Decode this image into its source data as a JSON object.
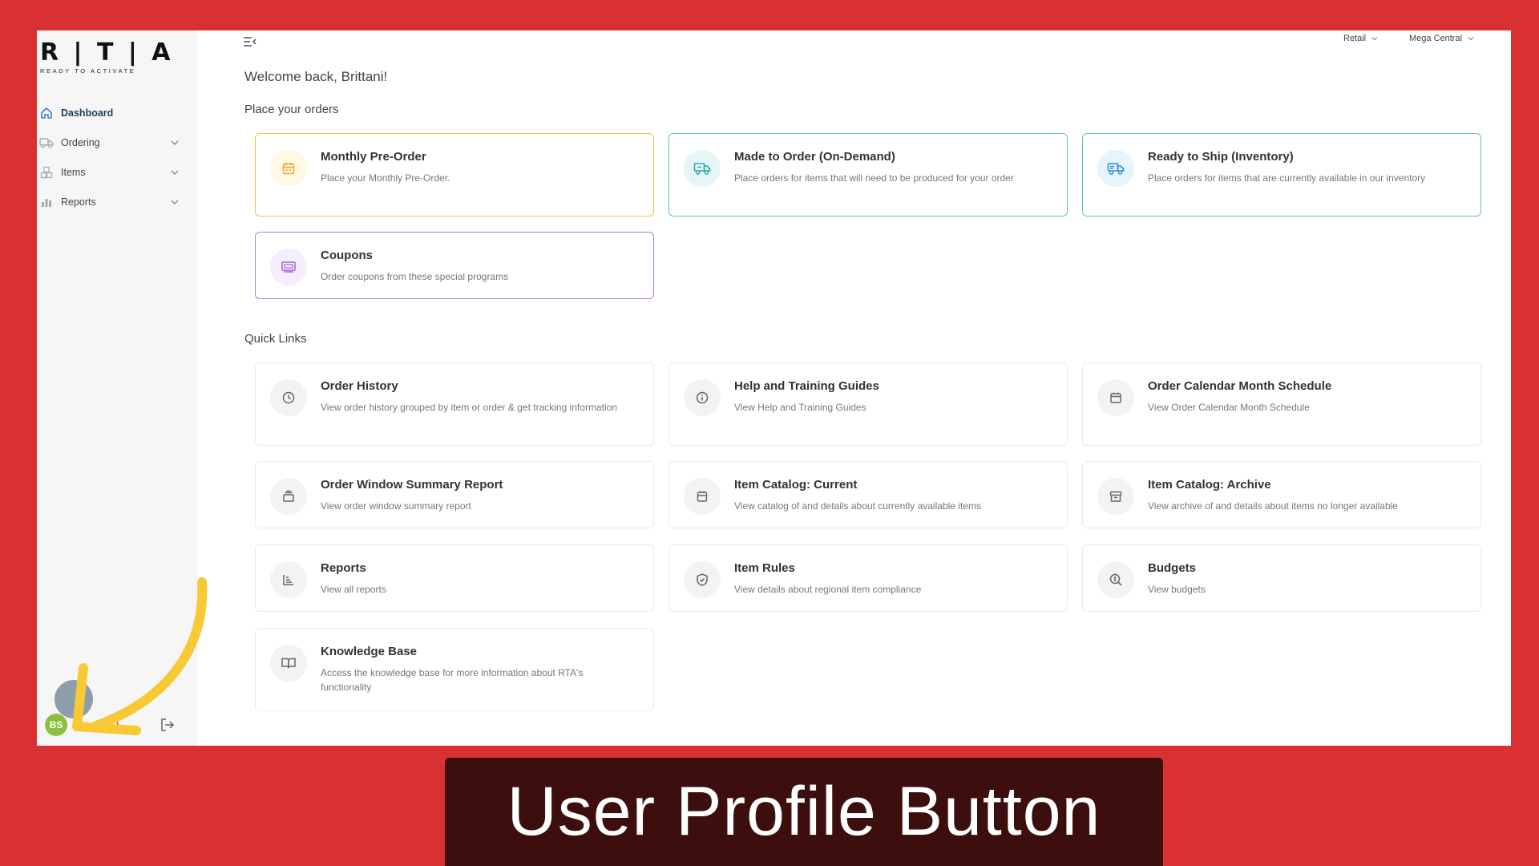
{
  "logo": {
    "text": "R | T | A",
    "tagline": "READY TO ACTIVATE"
  },
  "sidebar": {
    "items": [
      {
        "label": "Dashboard",
        "icon": "home-icon"
      },
      {
        "label": "Ordering",
        "icon": "truck-icon"
      },
      {
        "label": "Items",
        "icon": "boxes-icon"
      },
      {
        "label": "Reports",
        "icon": "bar-chart-icon"
      }
    ],
    "avatar_initials": "BS"
  },
  "topbar": {
    "channel": "Retail",
    "region": "Mega Central"
  },
  "welcome": "Welcome back, Brittani!",
  "orders": {
    "title": "Place your orders",
    "cards": [
      {
        "title": "Monthly Pre-Order",
        "desc": "Place your Monthly Pre-Order.",
        "accent": "#f0c24b"
      },
      {
        "title": "Made to Order (On-Demand)",
        "desc": "Place orders for items that will need to be produced for your order",
        "accent": "#5cc1c4"
      },
      {
        "title": "Ready to Ship (Inventory)",
        "desc": "Place orders for items that are currently available in our inventory",
        "accent": "#5cc1c4"
      },
      {
        "title": "Coupons",
        "desc": "Order coupons from these special programs",
        "accent": "#b27fd9"
      }
    ]
  },
  "quick_links": {
    "title": "Quick Links",
    "cards": [
      {
        "title": "Order History",
        "desc": "View order history grouped by item or order & get tracking information"
      },
      {
        "title": "Help and Training Guides",
        "desc": "View Help and Training Guides"
      },
      {
        "title": "Order Calendar Month Schedule",
        "desc": "View Order Calendar Month Schedule"
      },
      {
        "title": "Order Window Summary Report",
        "desc": "View order window summary report"
      },
      {
        "title": "Item Catalog: Current",
        "desc": "View catalog of and details about currently available items"
      },
      {
        "title": "Item Catalog: Archive",
        "desc": "View archive of and details about items no longer available"
      },
      {
        "title": "Reports",
        "desc": "View all reports"
      },
      {
        "title": "Item Rules",
        "desc": "View details about regional item compliance"
      },
      {
        "title": "Budgets",
        "desc": "View budgets"
      },
      {
        "title": "Knowledge Base",
        "desc": "Access the knowledge base for more information about RTA's functionality"
      }
    ]
  },
  "caption": "User Profile Button",
  "colors": {
    "background": "#d93132",
    "caption_bg": "#3c0e0e",
    "arrow": "#f7c935",
    "avatar": "#8cbf3f"
  }
}
